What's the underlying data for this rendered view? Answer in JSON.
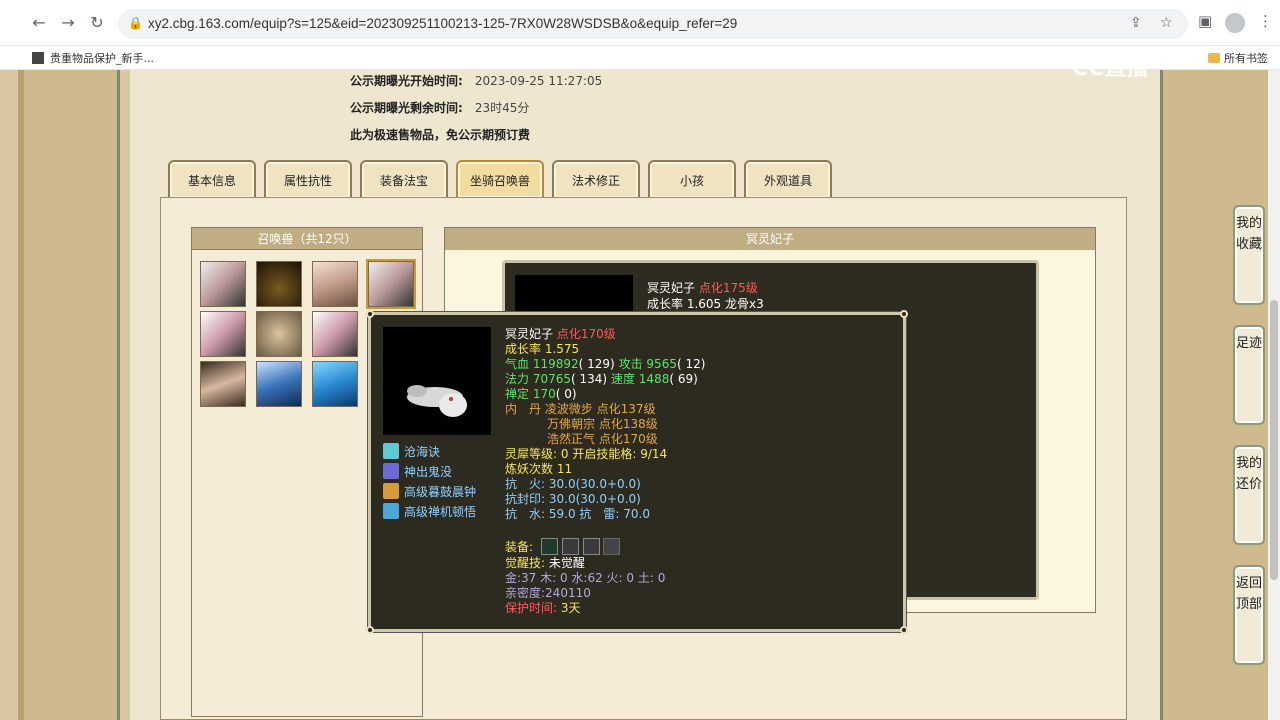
{
  "browser": {
    "url": "xy2.cbg.163.com/equip?s=125&eid=202309251100213-125-7RX0W28WSDSB&o&equip_refer=29",
    "bookmark": "贵重物品保护_新手...",
    "all_bookmarks": "所有书签"
  },
  "watermark": "CC直播",
  "notice": {
    "start_label": "公示期曝光开始时间:",
    "start_value": "2023-09-25 11:27:05",
    "remain_label": "公示期曝光剩余时间:",
    "remain_value": "23时45分",
    "fast_sale": "此为极速售物品，免公示期预订费"
  },
  "tabs": [
    "基本信息",
    "属性抗性",
    "装备法宝",
    "坐骑召唤兽",
    "法术修正",
    "小孩",
    "外观道具"
  ],
  "active_tab": 3,
  "pet_list": {
    "title": "召唤兽（共12只）"
  },
  "pet_detail": {
    "title": "冥灵妃子",
    "name": "冥灵妃子",
    "level": "点化175级",
    "growth": "成长率 1.605 龙骨x3"
  },
  "tooltip": {
    "name": "冥灵妃子",
    "level": "点化170级",
    "growth": "成长率 1.575",
    "hp_label": "气血",
    "hp": "119892",
    "hp_add": "( 129)",
    "atk_label": "攻击",
    "atk": "9565",
    "atk_add": "( 12)",
    "mp_label": "法力",
    "mp": "70765",
    "mp_add": "( 134)",
    "spd_label": "速度",
    "spd": "1488",
    "spd_add": "( 69)",
    "zen_label": "禅定",
    "zen": "170",
    "zen_add": "( 0)",
    "dan_label": "内　丹",
    "dan1": "凌波微步 点化137级",
    "dan2": "万佛朝宗 点化138级",
    "dan3": "浩然正气 点化170级",
    "soul_label": "灵犀等级:",
    "soul_value": "0 开启技能格:",
    "soul_slots": "9/14",
    "refine": "炼妖次数 11",
    "res1": "抗　火: 30.0(30.0+0.0)",
    "res2": "抗封印: 30.0(30.0+0.0)",
    "res3": "抗　水: 59.0 抗　雷: 70.0",
    "equip_label": "装备:",
    "awaken_label": "觉醒技:",
    "awaken_value": "未觉醒",
    "elements": "金:37 木: 0 水:62 火: 0 土: 0",
    "intimacy": "亲密度:240110",
    "protect_label": "保护时间:",
    "protect_value": "3天",
    "skills": [
      "沧海诀",
      "神出鬼没",
      "高级暮鼓晨钟",
      "高级禅机顿悟"
    ]
  },
  "float_buttons": {
    "favorites": "我的收藏",
    "footprint": "足迹",
    "bargain": "我的还价",
    "top": "返回顶部"
  }
}
